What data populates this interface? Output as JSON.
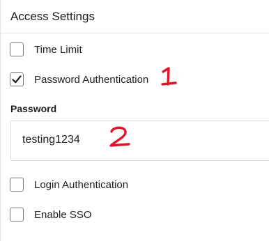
{
  "section": {
    "title": "Access Settings"
  },
  "options": [
    {
      "label": "Time Limit",
      "checked": false
    },
    {
      "label": "Password Authentication",
      "checked": true
    },
    {
      "label": "Login Authentication",
      "checked": false
    },
    {
      "label": "Enable SSO",
      "checked": false
    }
  ],
  "password": {
    "label": "Password",
    "value": "testing1234"
  },
  "annotations": {
    "first": "1",
    "second": "2",
    "color": "#e0142d"
  }
}
